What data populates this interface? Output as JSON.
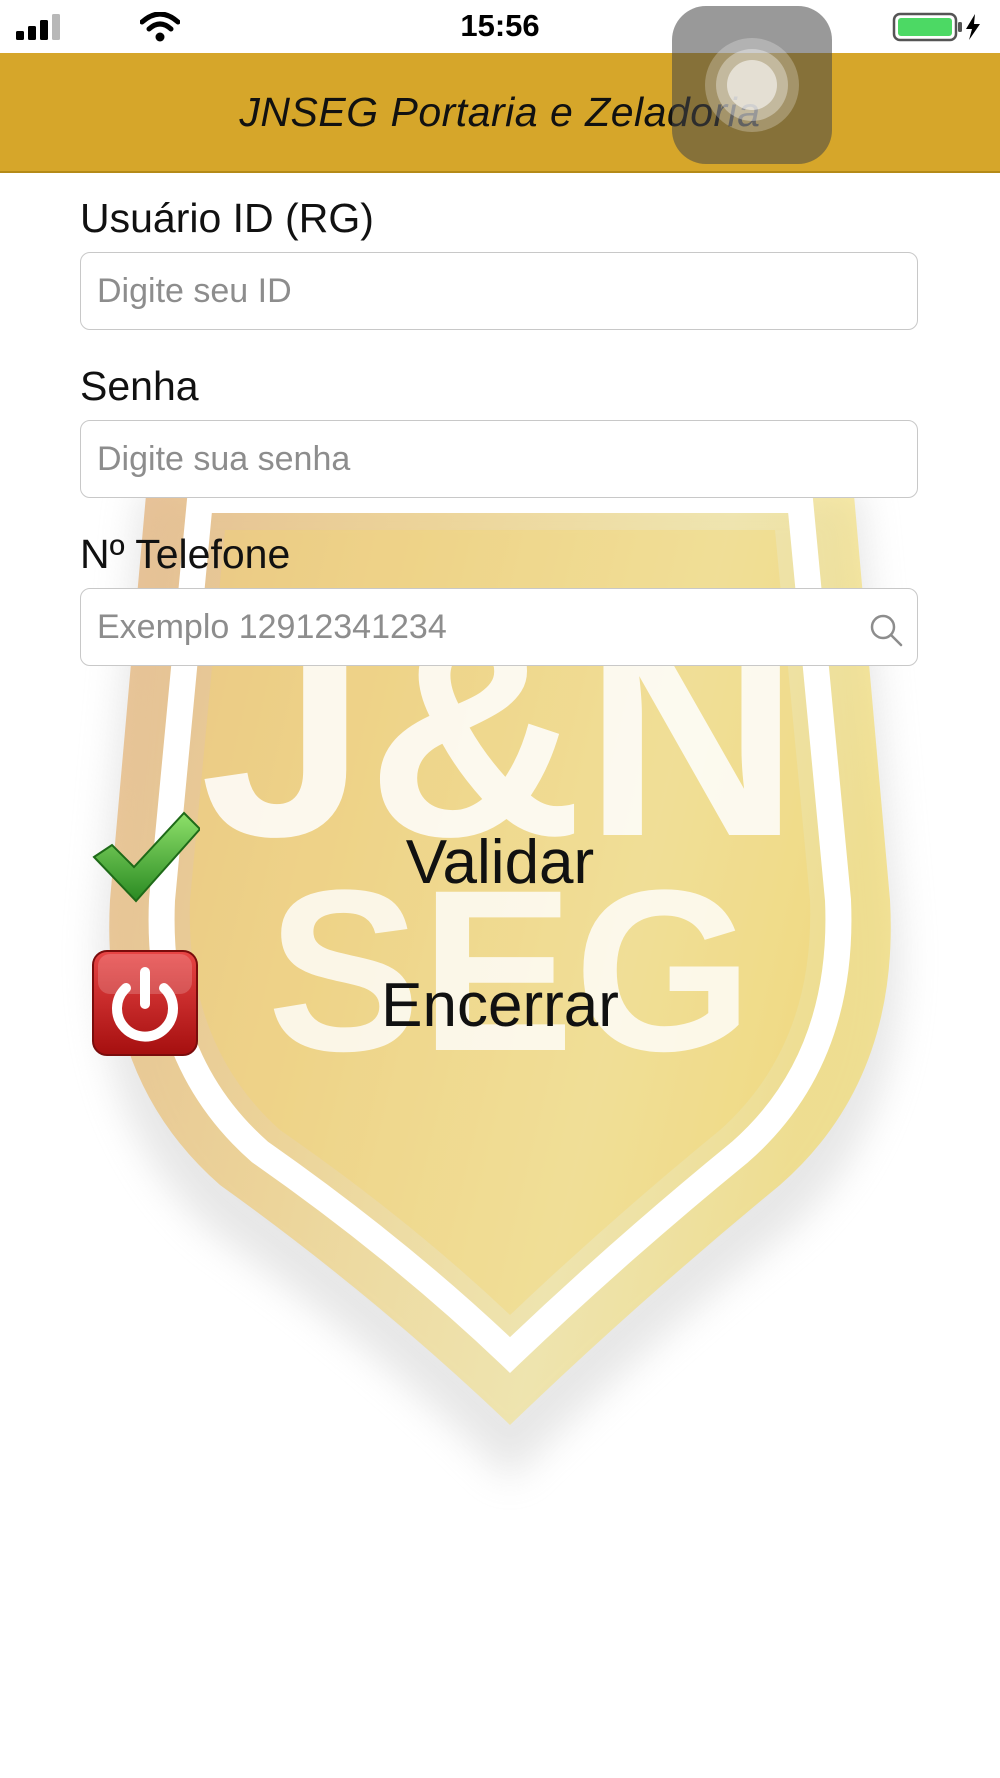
{
  "status_bar": {
    "time": "15:56"
  },
  "header": {
    "title": "JNSEG Portaria e Zeladoria"
  },
  "watermark": {
    "logo_text_top": "J&N",
    "logo_text_bottom": "SEG"
  },
  "form": {
    "user_id": {
      "label": "Usuário ID (RG)",
      "placeholder": "Digite seu ID",
      "value": ""
    },
    "password": {
      "label": "Senha",
      "placeholder": "Digite sua senha",
      "value": ""
    },
    "phone": {
      "label": "Nº Telefone",
      "placeholder": "Exemplo 12912341234",
      "value": ""
    }
  },
  "actions": {
    "validate_label": "Validar",
    "close_label": "Encerrar"
  },
  "colors": {
    "header_bg": "#d6a62a",
    "validate_icon": "#3aa12e",
    "close_icon": "#c81a1a",
    "battery": "#4cd964"
  },
  "icons": [
    "signal-icon",
    "wifi-icon",
    "battery-icon",
    "charging-icon",
    "search-icon",
    "checkmark-icon",
    "power-icon"
  ]
}
